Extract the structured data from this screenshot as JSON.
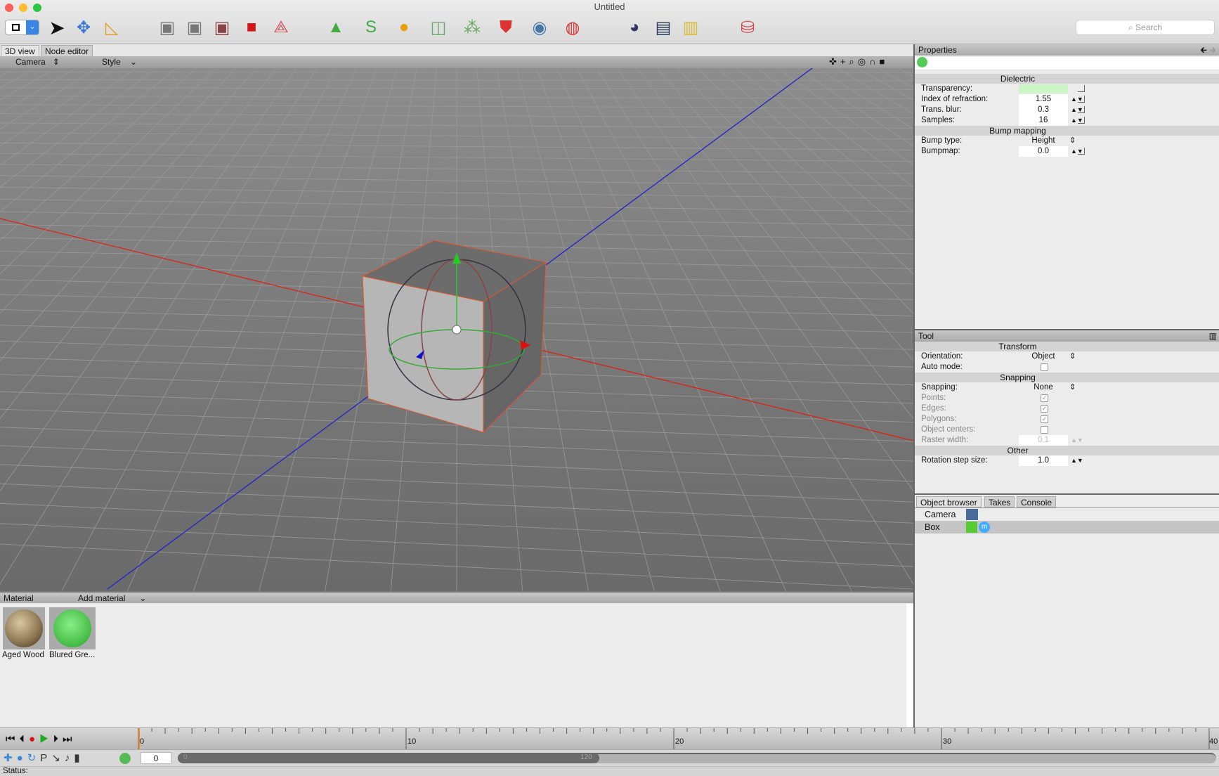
{
  "window": {
    "title": "Untitled"
  },
  "toolbar": {
    "search_placeholder": "Search",
    "icons": [
      "layout-toggle",
      "select-arrow",
      "transform-gizmo",
      "measure-ruler",
      "point-mode",
      "edge-mode",
      "polygon-mode",
      "object-mode",
      "axis-mode",
      "primitives",
      "spline",
      "generators",
      "deformer",
      "array",
      "tag",
      "camera",
      "light",
      "environment",
      "render-settings",
      "render",
      "render-view",
      "scale-weight"
    ]
  },
  "view_tabs": [
    {
      "label": "3D view",
      "active": true
    },
    {
      "label": "Node editor",
      "active": false
    }
  ],
  "viewport_bar": {
    "camera": "Camera",
    "style": "Style"
  },
  "properties": {
    "title": "Properties",
    "section1": "Dielectric",
    "rows1": [
      {
        "label": "Transparency:",
        "value": ""
      },
      {
        "label": "Index of refraction:",
        "value": "1.55"
      },
      {
        "label": "Trans. blur:",
        "value": "0.3"
      },
      {
        "label": "Samples:",
        "value": "16"
      }
    ],
    "section2": "Bump mapping",
    "bump_type_label": "Bump type:",
    "bump_type": "Height",
    "bumpmap_label": "Bumpmap:",
    "bumpmap": "0.0",
    "transparency_color": "#ccf5c8"
  },
  "tool": {
    "title": "Tool",
    "transform": "Transform",
    "orientation_label": "Orientation:",
    "orientation": "Object",
    "auto_mode_label": "Auto mode:",
    "snapping_section": "Snapping",
    "snapping_label": "Snapping:",
    "snapping": "None",
    "checks": [
      {
        "label": "Points:",
        "checked": true
      },
      {
        "label": "Edges:",
        "checked": true
      },
      {
        "label": "Polygons:",
        "checked": true
      },
      {
        "label": "Object centers:",
        "checked": false
      }
    ],
    "raster_label": "Raster width:",
    "raster": "0.1",
    "other": "Other",
    "rotation_label": "Rotation step size:",
    "rotation": "1.0"
  },
  "browser": {
    "tabs": [
      "Object browser",
      "Takes",
      "Console"
    ],
    "objects": [
      {
        "name": "Camera",
        "selected": false
      },
      {
        "name": "Box",
        "selected": true
      }
    ]
  },
  "material": {
    "title": "Material",
    "add": "Add material",
    "items": [
      {
        "name": "Aged Wood"
      },
      {
        "name": "Blured Gre..."
      }
    ]
  },
  "timeline": {
    "ticks": [
      "0",
      "10",
      "20",
      "30",
      "40"
    ],
    "frame": "0",
    "range_start": "0",
    "range_end": "120"
  },
  "status": {
    "label": "Status:"
  }
}
